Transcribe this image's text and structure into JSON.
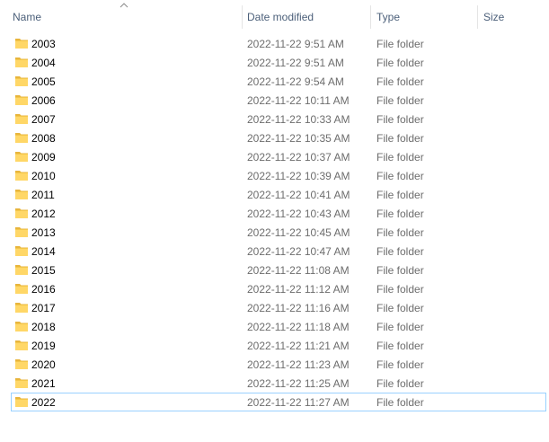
{
  "columns": {
    "name": "Name",
    "date_modified": "Date modified",
    "type": "Type",
    "size": "Size"
  },
  "sort": {
    "column": "name",
    "direction": "ascending",
    "icon": "chevron-up-icon"
  },
  "colors": {
    "folder_fill": "#ffd767",
    "folder_tab": "#e8b53c",
    "selection_border": "#99d1ff",
    "header_text": "#4c607a",
    "secondary_text": "#6d6d6d"
  },
  "rows": [
    {
      "name": "2003",
      "date": "2022-11-22 9:51 AM",
      "type": "File folder",
      "icon": "folder-icon"
    },
    {
      "name": "2004",
      "date": "2022-11-22 9:51 AM",
      "type": "File folder",
      "icon": "folder-icon"
    },
    {
      "name": "2005",
      "date": "2022-11-22 9:54 AM",
      "type": "File folder",
      "icon": "folder-icon"
    },
    {
      "name": "2006",
      "date": "2022-11-22 10:11 AM",
      "type": "File folder",
      "icon": "folder-icon"
    },
    {
      "name": "2007",
      "date": "2022-11-22 10:33 AM",
      "type": "File folder",
      "icon": "folder-icon"
    },
    {
      "name": "2008",
      "date": "2022-11-22 10:35 AM",
      "type": "File folder",
      "icon": "folder-icon"
    },
    {
      "name": "2009",
      "date": "2022-11-22 10:37 AM",
      "type": "File folder",
      "icon": "folder-icon"
    },
    {
      "name": "2010",
      "date": "2022-11-22 10:39 AM",
      "type": "File folder",
      "icon": "folder-icon"
    },
    {
      "name": "2011",
      "date": "2022-11-22 10:41 AM",
      "type": "File folder",
      "icon": "folder-icon"
    },
    {
      "name": "2012",
      "date": "2022-11-22 10:43 AM",
      "type": "File folder",
      "icon": "folder-icon"
    },
    {
      "name": "2013",
      "date": "2022-11-22 10:45 AM",
      "type": "File folder",
      "icon": "folder-icon"
    },
    {
      "name": "2014",
      "date": "2022-11-22 10:47 AM",
      "type": "File folder",
      "icon": "folder-icon"
    },
    {
      "name": "2015",
      "date": "2022-11-22 11:08 AM",
      "type": "File folder",
      "icon": "folder-icon"
    },
    {
      "name": "2016",
      "date": "2022-11-22 11:12 AM",
      "type": "File folder",
      "icon": "folder-icon"
    },
    {
      "name": "2017",
      "date": "2022-11-22 11:16 AM",
      "type": "File folder",
      "icon": "folder-icon"
    },
    {
      "name": "2018",
      "date": "2022-11-22 11:18 AM",
      "type": "File folder",
      "icon": "folder-icon"
    },
    {
      "name": "2019",
      "date": "2022-11-22 11:21 AM",
      "type": "File folder",
      "icon": "folder-icon"
    },
    {
      "name": "2020",
      "date": "2022-11-22 11:23 AM",
      "type": "File folder",
      "icon": "folder-icon"
    },
    {
      "name": "2021",
      "date": "2022-11-22 11:25 AM",
      "type": "File folder",
      "icon": "folder-icon"
    },
    {
      "name": "2022",
      "date": "2022-11-22 11:27 AM",
      "type": "File folder",
      "icon": "folder-icon",
      "selected": true
    }
  ]
}
